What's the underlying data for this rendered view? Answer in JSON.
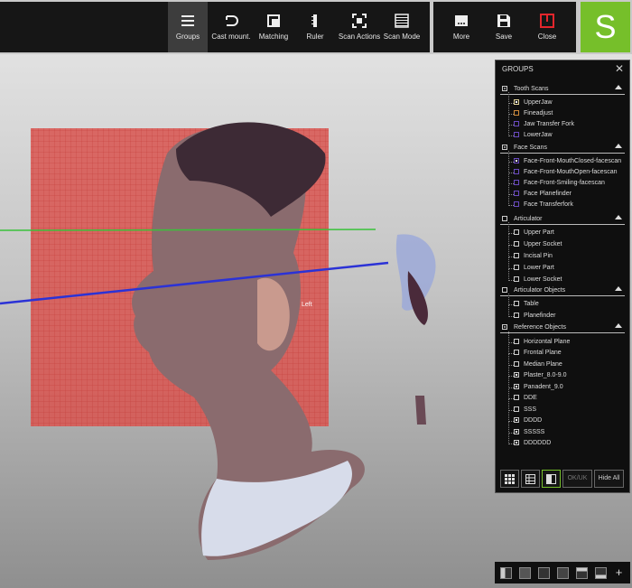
{
  "toolbar": {
    "buttons": [
      {
        "label": "Groups",
        "active": true
      },
      {
        "label": "Cast mount."
      },
      {
        "label": "Matching"
      },
      {
        "label": "Ruler"
      },
      {
        "label": "Scan Actions"
      },
      {
        "label": "Scan Mode"
      }
    ],
    "file_buttons": [
      {
        "label": "More"
      },
      {
        "label": "Save"
      },
      {
        "label": "Close"
      }
    ],
    "brand_letter": "S"
  },
  "viewport": {
    "label": "Left"
  },
  "panel": {
    "title": "GROUPS",
    "close": "✕",
    "sections": [
      {
        "title": "Tooth Scans",
        "state": "partial",
        "items": [
          {
            "label": "UpperJaw",
            "state": "checked",
            "color": "#e3d59a"
          },
          {
            "label": "Fineadjust",
            "state": "unchecked",
            "color": "#d08a3a"
          },
          {
            "label": "Jaw Transfer Fork",
            "state": "unchecked",
            "color": "#6a4ac0"
          },
          {
            "label": "LowerJaw",
            "state": "unchecked",
            "color": "#6a4ac0"
          }
        ]
      },
      {
        "title": "Face Scans",
        "state": "partial",
        "items": [
          {
            "label": "Face-Front-MouthClosed-facescan",
            "state": "checked",
            "color": "#6a4ac0"
          },
          {
            "label": "Face-Front-MouthOpen-facescan",
            "state": "unchecked",
            "color": "#6a4ac0"
          },
          {
            "label": "Face-Front-Smiling-facescan",
            "state": "unchecked",
            "color": "#6a4ac0"
          },
          {
            "label": "Face Planefinder",
            "state": "unchecked",
            "color": "#6a4ac0"
          },
          {
            "label": "Face Transferfork",
            "state": "unchecked",
            "color": "#6a4ac0"
          }
        ]
      },
      {
        "title": "Articulator",
        "state": "unchecked",
        "items": [
          {
            "label": "Upper Part",
            "state": "unchecked"
          },
          {
            "label": "Upper Socket",
            "state": "unchecked"
          },
          {
            "label": "Incisal Pin",
            "state": "unchecked"
          },
          {
            "label": "Lower Part",
            "state": "unchecked"
          },
          {
            "label": "Lower Socket",
            "state": "unchecked"
          }
        ]
      },
      {
        "title": "Articulator Objects",
        "state": "unchecked",
        "items": [
          {
            "label": "Table",
            "state": "unchecked"
          },
          {
            "label": "Planefinder",
            "state": "unchecked"
          }
        ]
      },
      {
        "title": "Reference Objects",
        "state": "partial",
        "items": [
          {
            "label": "Horizontal Plane",
            "state": "unchecked"
          },
          {
            "label": "Frontal Plane",
            "state": "unchecked"
          },
          {
            "label": "Median Plane",
            "state": "unchecked"
          },
          {
            "label": "Plaster_8.0-9.0",
            "state": "checked"
          },
          {
            "label": "Panadent_9.0",
            "state": "checked"
          },
          {
            "label": "DDE",
            "state": "unchecked"
          },
          {
            "label": "SSS",
            "state": "unchecked"
          },
          {
            "label": "DDDD",
            "state": "checked"
          },
          {
            "label": "SSSSS",
            "state": "checked"
          },
          {
            "label": "DDDDDD",
            "state": "checked"
          }
        ]
      }
    ],
    "buttons": {
      "ok": "OK/UK",
      "hide_all": "Hide All"
    }
  },
  "colors": {
    "accent": "#76bf2a",
    "plane_red": "#d9534f",
    "axis_green": "#39c23a",
    "axis_blue": "#2b32d6",
    "close_red": "#e3262c"
  }
}
